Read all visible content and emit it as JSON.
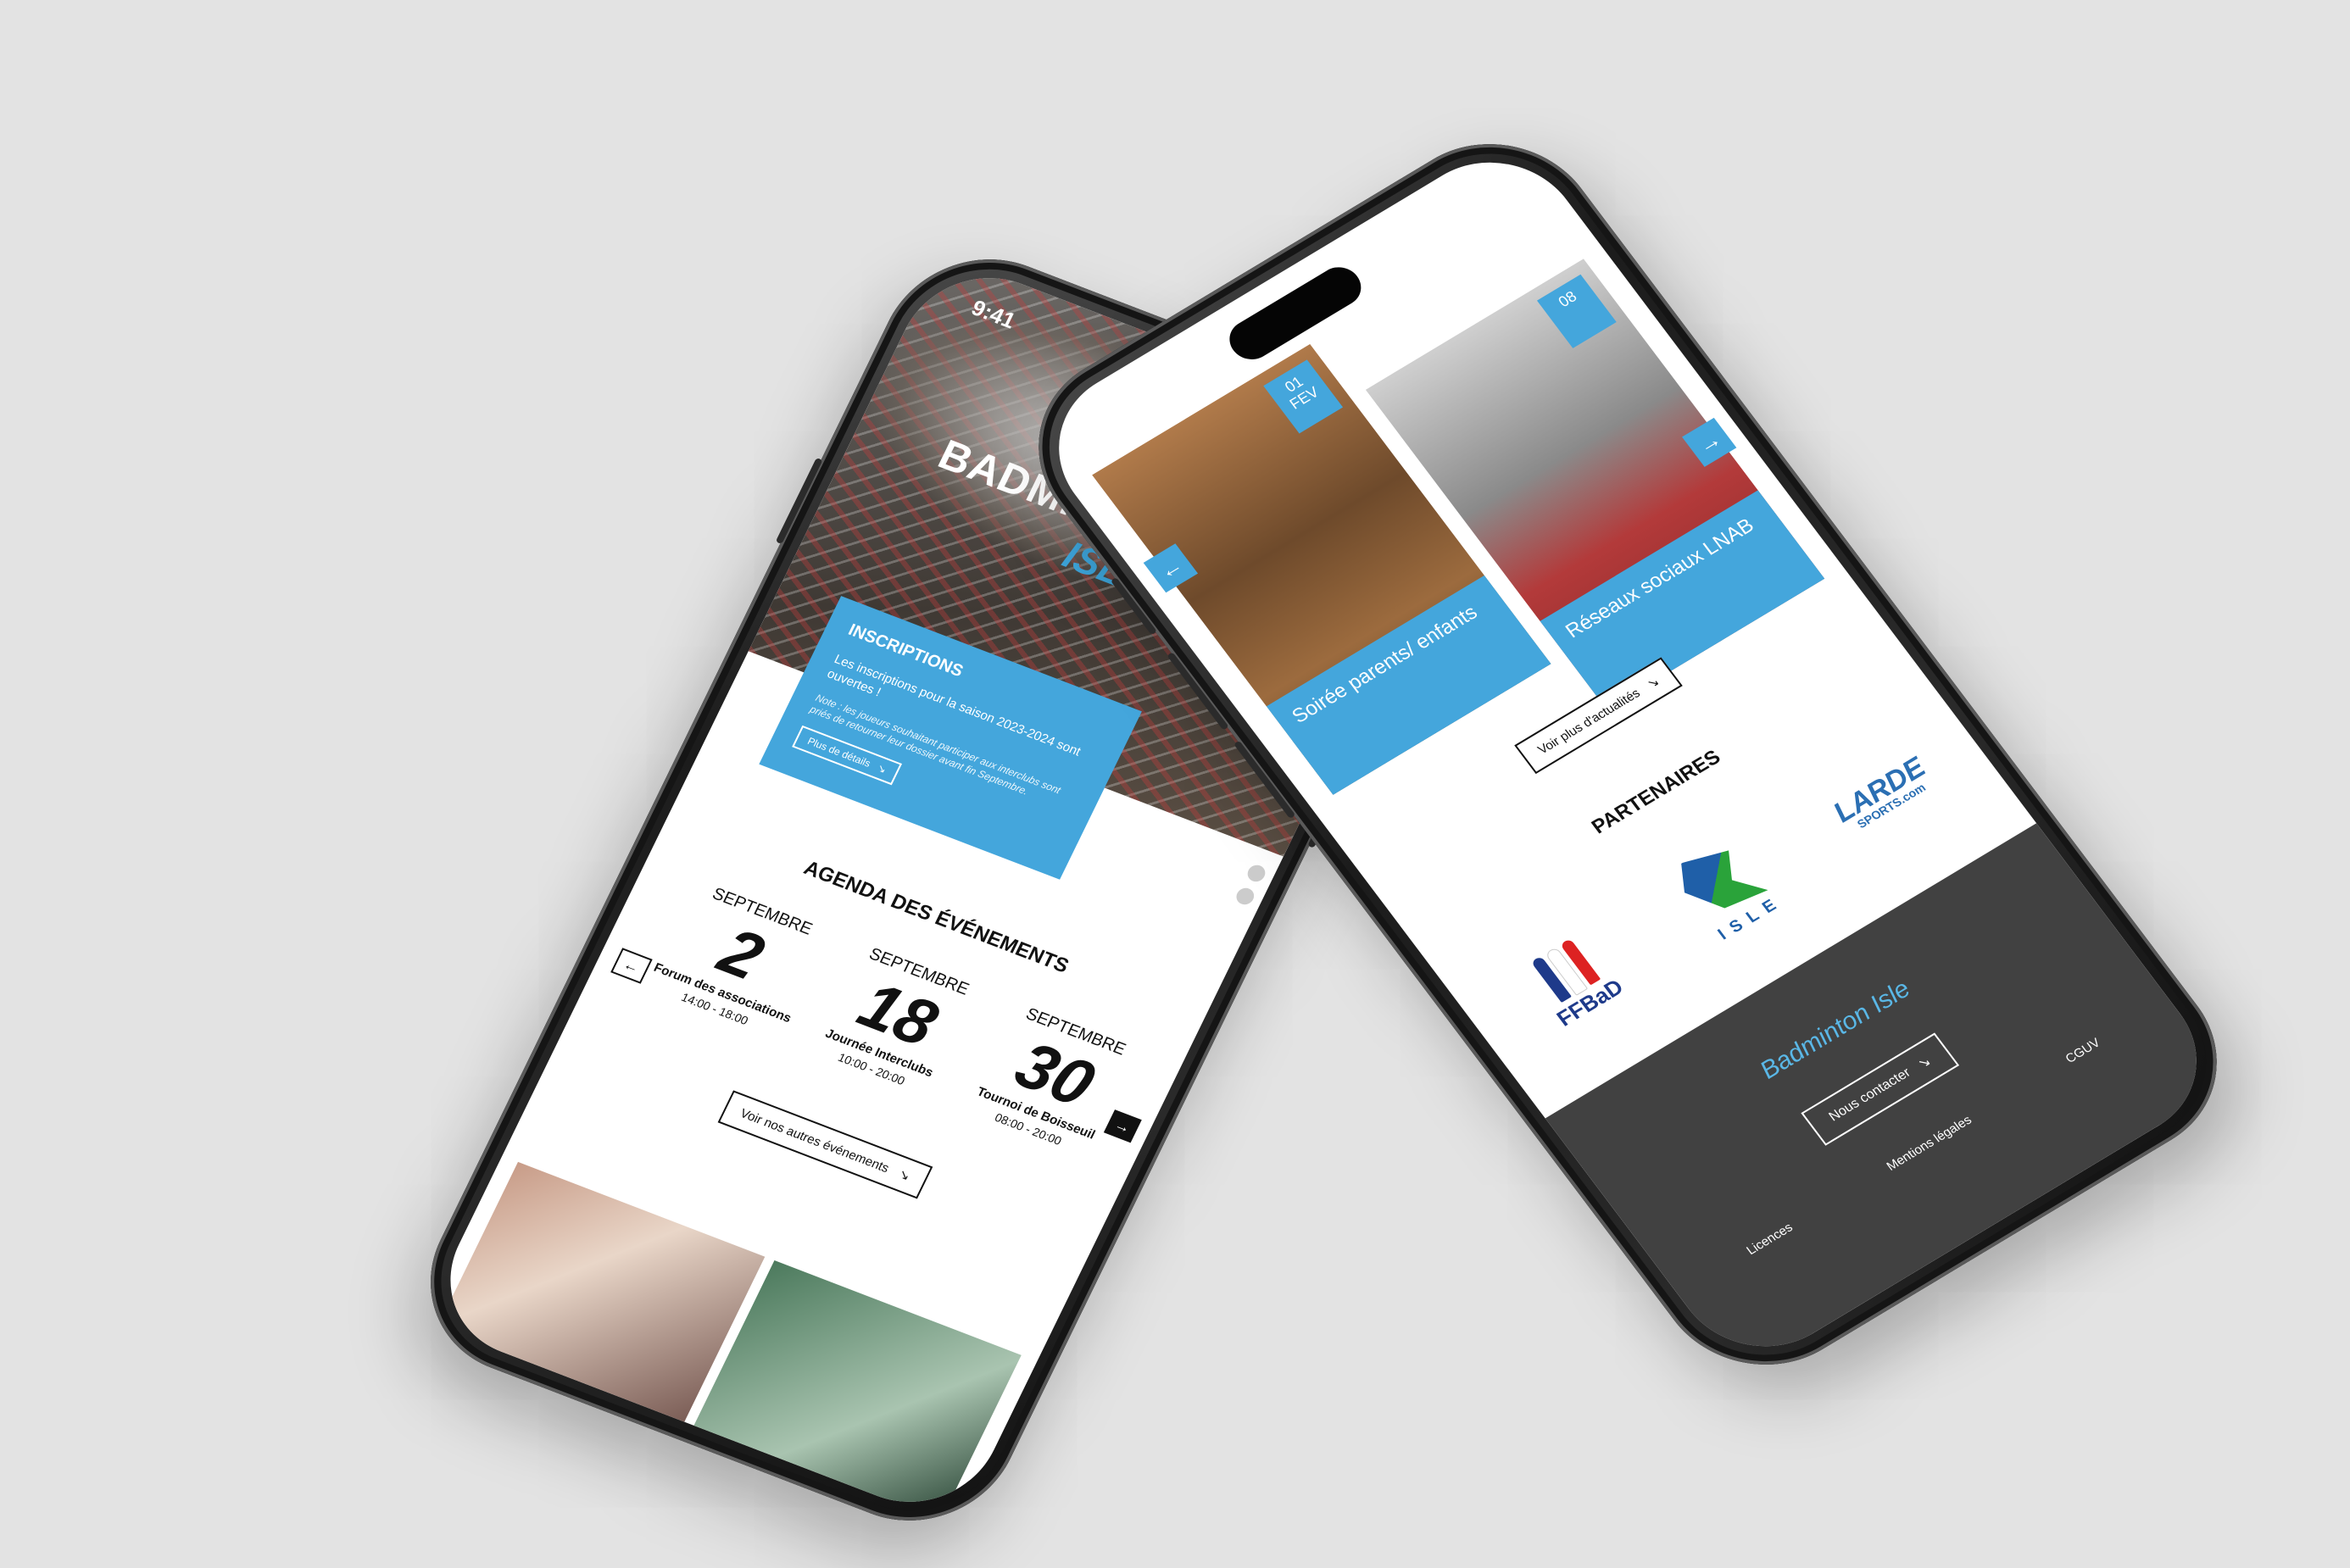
{
  "statusbar": {
    "time": "9:41"
  },
  "hero": {
    "title": "BADMINTON CLUB",
    "subtitle": "ISLE"
  },
  "inscriptions": {
    "title": "INSCRIPTIONS",
    "text": "Les inscriptions pour la saison 2023-2024 sont ouvertes !",
    "note": "Note : les joueurs souhaitant participer aux interclubs sont priés de retourner leur dossier avant fin Septembre.",
    "button": "Plus de détails",
    "button_icon": "arrow-down-right-icon"
  },
  "agenda": {
    "title": "AGENDA DES ÉVÉNEMENTS",
    "prev_icon": "←",
    "next_icon": "→",
    "events": [
      {
        "month": "SEPTEMBRE",
        "day": "2",
        "name": "Forum des associations",
        "hours": "14:00 - 18:00"
      },
      {
        "month": "SEPTEMBRE",
        "day": "18",
        "name": "Journée Interclubs",
        "hours": "10:00 - 20:00"
      },
      {
        "month": "SEPTEMBRE",
        "day": "30",
        "name": "Tournoi de Boisseuil",
        "hours": "08:00 - 20:00"
      }
    ],
    "more_button": "Voir nos autres événements"
  },
  "news": {
    "prev_icon": "←",
    "next_icon": "→",
    "cards": [
      {
        "day": "01",
        "month": "FEV",
        "title": "Soirée parents/ enfants"
      },
      {
        "day": "08",
        "month": "",
        "title": "Réseaux sociaux LNAB"
      }
    ],
    "more_button": "Voir plus d'actualités"
  },
  "partners": {
    "title": "PARTENAIRES",
    "ffbad": "FFBaD",
    "isle": "ISLE",
    "larde": "LARDE",
    "larde_sub": "SPORTS.com"
  },
  "footer": {
    "logo": "Badminton Isle",
    "contact_button": "Nous contacter",
    "links": [
      "Licences",
      "Mentions légales",
      "CGUV"
    ]
  },
  "colors": {
    "accent": "#44a6dc",
    "footer": "#414141"
  }
}
